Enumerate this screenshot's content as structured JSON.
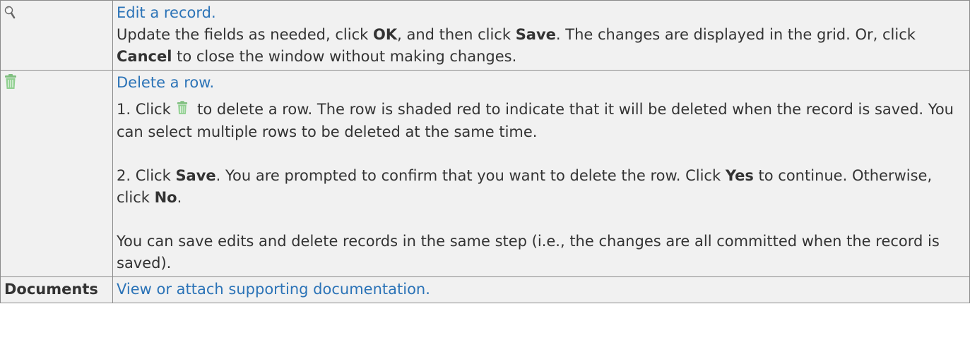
{
  "rows": {
    "edit": {
      "icon": "magnifier-icon",
      "link": "Edit a record.",
      "t1": "Update the fields as needed, click ",
      "b1": "OK",
      "t2": ", and then click ",
      "b2": "Save",
      "t3": ". The changes are displayed in the grid. Or, click ",
      "b3": "Cancel",
      "t4": " to close the window without making changes."
    },
    "delete": {
      "icon": "trash-icon",
      "link": "Delete a row.",
      "s1_pre": "1. Click ",
      "s1_post": " to delete a row. The row is shaded red to indicate that it will be deleted when the record is saved. You can select multiple rows to be deleted at the same time.",
      "s2_t1": "2. Click ",
      "s2_b1": "Save",
      "s2_t2": ". You are prompted to confirm that you want to delete the row. Click ",
      "s2_b2": "Yes",
      "s2_t3": " to continue. Otherwise, click ",
      "s2_b3": "No",
      "s2_t4": ".",
      "note": "You can save edits and delete records in the same step (i.e., the changes are all committed when the record is saved)."
    },
    "documents": {
      "label": "Documents",
      "link": "View or attach supporting documentation."
    }
  },
  "colors": {
    "link": "#2b73b7",
    "cell_bg": "#f1f1f1",
    "border": "#8b8b8b",
    "trash": "#7fbf7f"
  }
}
